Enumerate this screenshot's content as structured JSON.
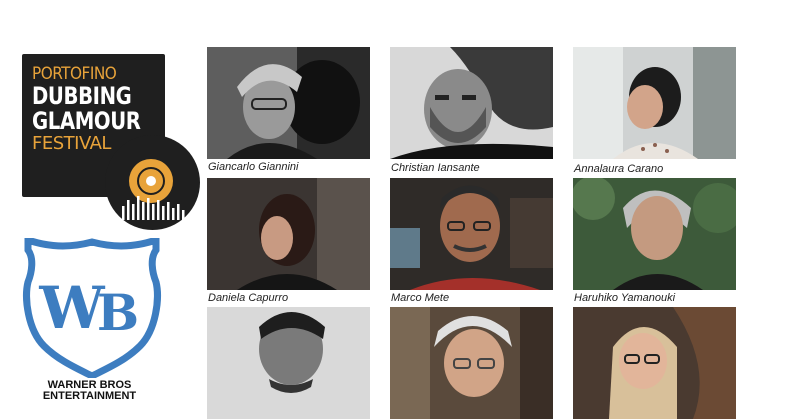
{
  "festival_logo": {
    "line1": "PORTOFINO",
    "line2": "DUBBING",
    "line3": "GLAMOUR",
    "line4": "FESTIVAL",
    "colors": {
      "background": "#1f1f1f",
      "accent": "#e8a33a",
      "text": "#ffffff"
    }
  },
  "wb_logo": {
    "line1": "WARNER BROS",
    "line2": "ENTERTAINMENT",
    "color": "#3d7dc0"
  },
  "people": [
    {
      "name": "Giancarlo Giannini"
    },
    {
      "name": "Christian Iansante"
    },
    {
      "name": "Annalaura Carano"
    },
    {
      "name": "Daniela Capurro"
    },
    {
      "name": "Marco Mete"
    },
    {
      "name": "Haruhiko Yamanouki"
    },
    {
      "name": ""
    },
    {
      "name": ""
    },
    {
      "name": ""
    }
  ]
}
